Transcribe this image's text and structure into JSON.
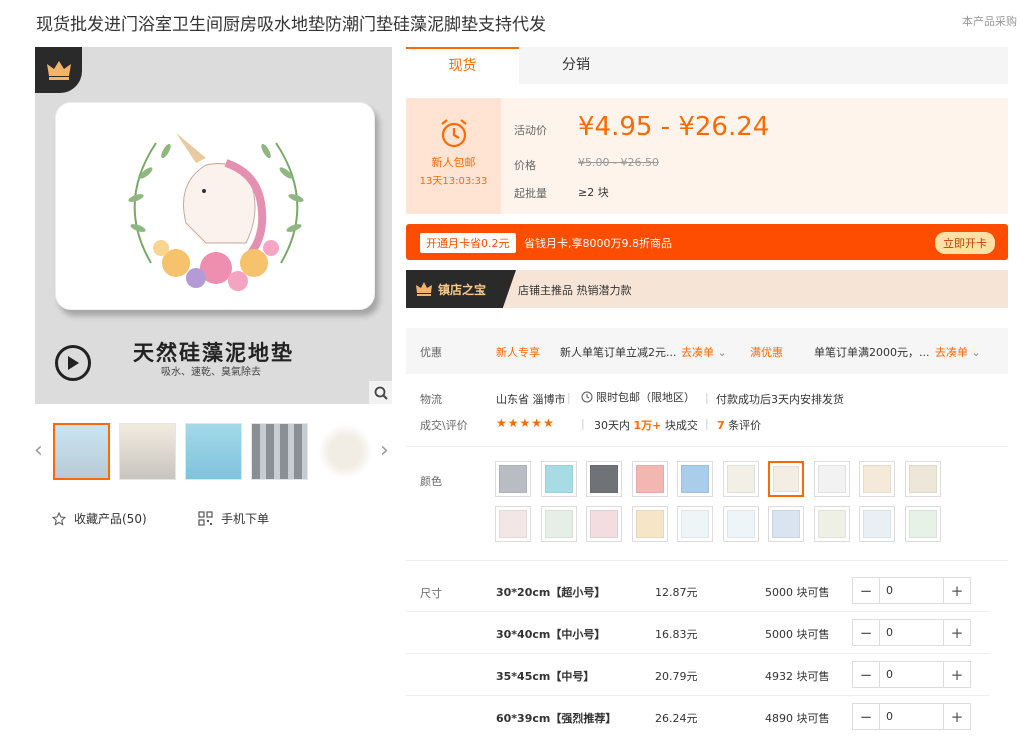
{
  "title": "现货批发进门浴室卫生间厨房吸水地垫防潮门垫硅藻泥脚垫支持代发",
  "top_right": "本产品采购",
  "gallery": {
    "caption": "天然硅藻泥地垫",
    "subcaption": "吸水、速乾、臭氣除去",
    "favorite_label": "收藏产品(50)",
    "mobile_label": "手机下单",
    "prev_icon": "chevron-left-icon",
    "next_icon": "chevron-right-icon"
  },
  "tabs": [
    {
      "label": "现货"
    },
    {
      "label": "分销"
    }
  ],
  "price_box": {
    "promo_tag": "新人包邮",
    "countdown": "13天13:03:33",
    "activity_label": "活动价",
    "activity_price": "¥4.95 - ¥26.24",
    "price_label": "价格",
    "original_price": "¥5.00 - ¥26.50",
    "moq_label": "起批量",
    "moq_value": "≥2 块"
  },
  "month_card": {
    "tag": "开通月卡省0.2元",
    "text": "省钱月卡,享8000万9.8折商品",
    "button": "立即开卡"
  },
  "treasure": {
    "badge": "镇店之宝",
    "text": "店铺主推品  热销潜力款"
  },
  "promo": {
    "label": "优惠",
    "tag1": "新人专享",
    "desc1": "新人单笔订单立减2元...",
    "link1": "去凑单",
    "tag2": "满优惠",
    "desc2": "单笔订单满2000元，...",
    "link2": "去凑单"
  },
  "logistics": {
    "label": "物流",
    "origin": "山东省 淄博市",
    "shipping": "限时包邮（限地区）",
    "delivery": "付款成功后3天内安排发货"
  },
  "deals": {
    "label": "成交\\评价",
    "period": "30天内",
    "count": "1万+",
    "unit": "块成交",
    "reviews": "7",
    "reviews_unit": "条评价",
    "rating": 5
  },
  "color": {
    "label": "颜色",
    "selected_index": 6,
    "swatches": [
      "#b9bdc3",
      "#a8dce4",
      "#6f7276",
      "#f3b7b1",
      "#a9cdea",
      "#f1efe6",
      "#f4ede4",
      "#f2f2f2",
      "#f5ead9",
      "#efe6da",
      "#f3e6e6",
      "#e6eee8",
      "#f3dde0",
      "#f6e6c7",
      "#eef5f7",
      "#eef5f8",
      "#d9e4f0",
      "#eef0e6",
      "#e8f0f6",
      "#e7f2e7"
    ]
  },
  "sizes": {
    "label": "尺寸",
    "rows": [
      {
        "name": "30*20cm【超小号】",
        "price": "12.87元",
        "stock": "5000 块可售",
        "qty": "0"
      },
      {
        "name": "30*40cm【中小号】",
        "price": "16.83元",
        "stock": "5000 块可售",
        "qty": "0"
      },
      {
        "name": "35*45cm【中号】",
        "price": "20.79元",
        "stock": "4932 块可售",
        "qty": "0"
      },
      {
        "name": "60*39cm【强烈推荐】",
        "price": "26.24元",
        "stock": "4890 块可售",
        "qty": "0"
      }
    ]
  },
  "colors": {
    "accent": "#ff6a00",
    "card": "#ff4d00"
  }
}
